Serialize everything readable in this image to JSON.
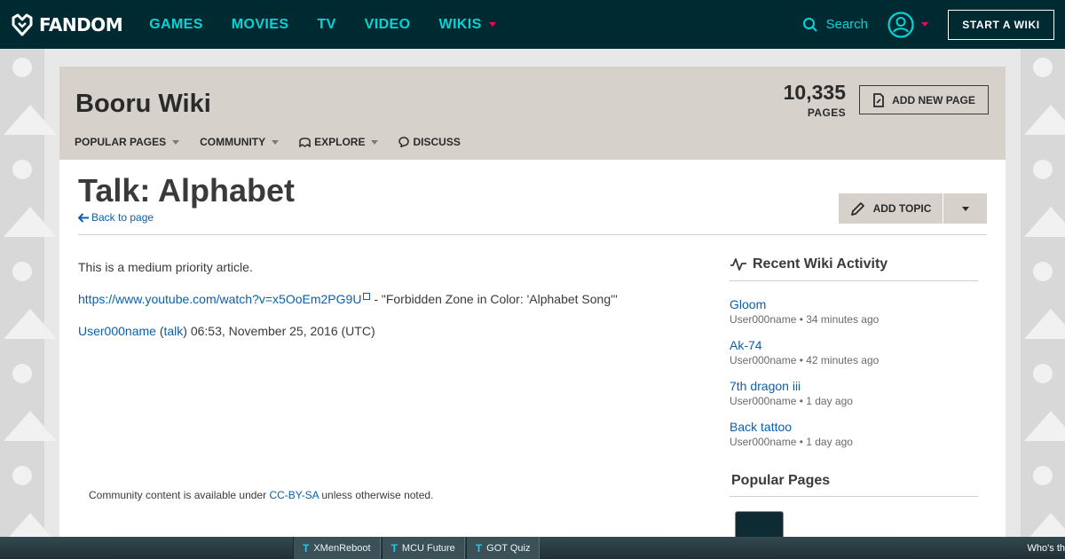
{
  "topnav": {
    "logo_text": "FANDOM",
    "links": [
      "GAMES",
      "MOVIES",
      "TV",
      "VIDEO",
      "WIKIS"
    ],
    "search_label": "Search",
    "start_wiki_label": "START A WIKI"
  },
  "wiki": {
    "title": "Booru Wiki",
    "page_count": "10,335",
    "page_count_label": "PAGES",
    "add_page_label": "ADD NEW PAGE",
    "nav": [
      "POPULAR PAGES",
      "COMMUNITY",
      "EXPLORE",
      "DISCUSS"
    ]
  },
  "page": {
    "title": "Talk: Alphabet",
    "back_link": "Back to page",
    "add_topic_label": "ADD TOPIC",
    "priority_text": "This is a medium priority article.",
    "video_url": "https://www.youtube.com/watch?v=x5OoEm2PG9U",
    "video_desc": " - \"Forbidden Zone in Color: 'Alphabet Song'\"",
    "sig_user": "User000name",
    "sig_open": " (",
    "sig_talk": "talk",
    "sig_time": ") 06:53, November 25, 2016 (UTC)"
  },
  "footer": {
    "prefix": "Community content is available under ",
    "license": "CC-BY-SA",
    "suffix": " unless otherwise noted."
  },
  "rail": {
    "activity_heading": "Recent Wiki Activity",
    "activity": [
      {
        "title": "Gloom",
        "meta": "User000name • 34 minutes ago"
      },
      {
        "title": "Ak-74",
        "meta": "User000name • 42 minutes ago"
      },
      {
        "title": "7th dragon iii",
        "meta": "User000name • 1 day ago"
      },
      {
        "title": "Back tattoo",
        "meta": "User000name • 1 day ago"
      }
    ],
    "popular_heading": "Popular Pages"
  },
  "bottom_bar": {
    "tabs": [
      "XMenReboot",
      "MCU Future",
      "GOT Quiz"
    ],
    "right_text": "Who's th"
  },
  "colors": {
    "nav_bg": "#002a32",
    "nav_link": "#00d6d6",
    "accent_red": "#fa005a",
    "header_bg": "#d6d2cb",
    "link": "#0b5fab"
  }
}
